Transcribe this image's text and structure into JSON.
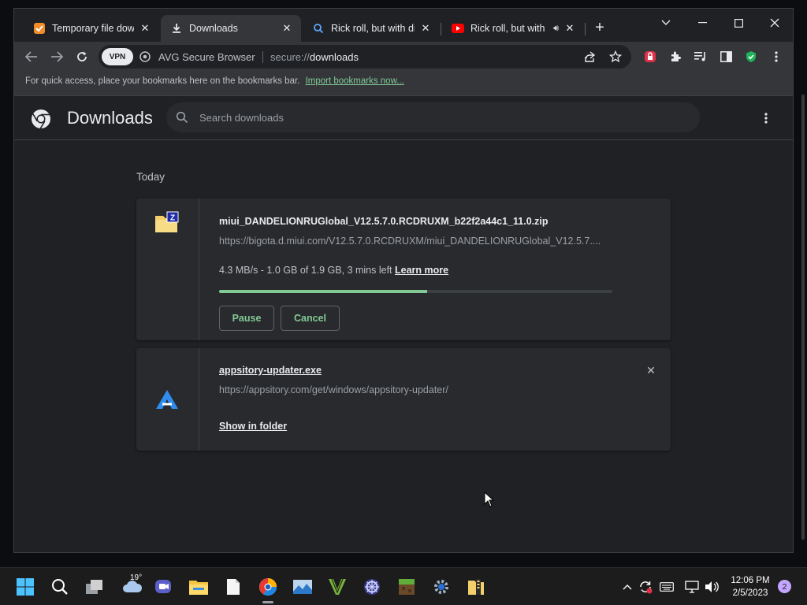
{
  "tabs": [
    {
      "title": "Temporary file downl",
      "favicon": "orange-check-icon"
    },
    {
      "title": "Downloads",
      "favicon": "download-icon"
    },
    {
      "title": "Rick roll, but with diff",
      "favicon": "search-icon"
    },
    {
      "title": "Rick roll, but with",
      "favicon": "youtube-icon"
    }
  ],
  "toolbar": {
    "vpn_label": "VPN",
    "brand": "AVG Secure Browser",
    "url_scheme": "secure://",
    "url_path": "downloads"
  },
  "bookmarks": {
    "text": "For quick access, place your bookmarks here on the bookmarks bar.",
    "link": "Import bookmarks now..."
  },
  "downloads": {
    "title": "Downloads",
    "search_placeholder": "Search downloads",
    "date_label": "Today",
    "items": [
      {
        "filename": "miui_DANDELIONRUGlobal_V12.5.7.0.RCDRUXM_b22f2a44c1_11.0.zip",
        "url": "https://bigota.d.miui.com/V12.5.7.0.RCDRUXM/miui_DANDELIONRUGlobal_V12.5.7....",
        "status": "4.3 MB/s - 1.0 GB of 1.9 GB, 3 mins left",
        "learn_more": "Learn more",
        "progress": 0.53,
        "pause_label": "Pause",
        "cancel_label": "Cancel"
      },
      {
        "filename": "appsitory-updater.exe",
        "url": "https://appsitory.com/get/windows/appsitory-updater/",
        "show_in_folder": "Show in folder"
      }
    ]
  },
  "taskbar": {
    "weather_temp": "19°",
    "time": "12:06 PM",
    "date": "2/5/2023",
    "notification_count": "2"
  },
  "colors": {
    "accent_green": "#81c995",
    "bg": "#202124",
    "card": "#292a2d"
  }
}
